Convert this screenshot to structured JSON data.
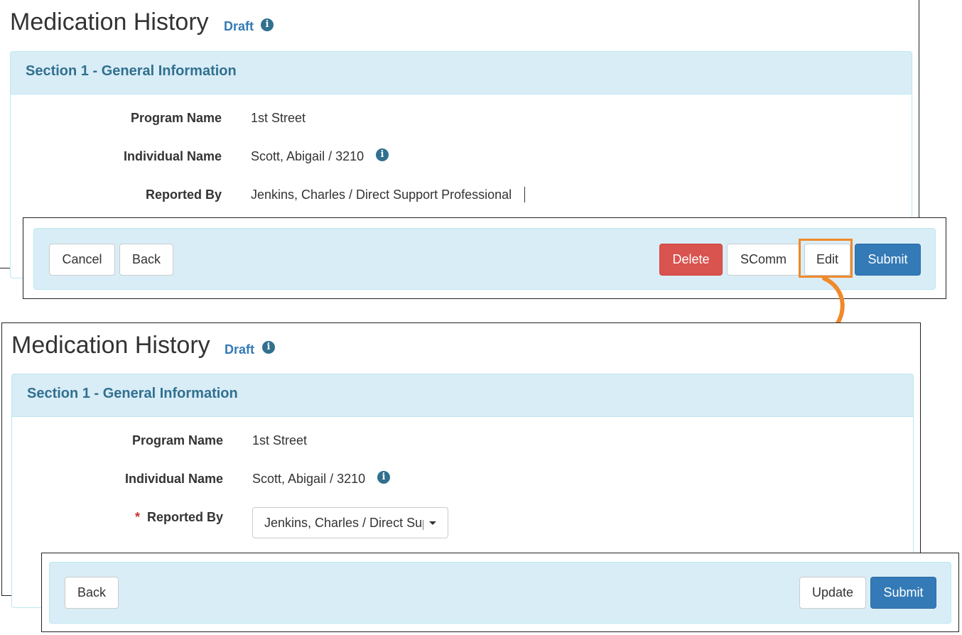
{
  "view_screen": {
    "title": "Medication History",
    "status": "Draft",
    "section_title": "Section 1 - General Information",
    "fields": [
      {
        "label": "Program Name",
        "value": "1st Street"
      },
      {
        "label": "Individual Name",
        "value": "Scott, Abigail / 3210"
      },
      {
        "label": "Reported By",
        "value": "Jenkins, Charles / Direct Support Professional"
      }
    ],
    "buttons": {
      "cancel": "Cancel",
      "back": "Back",
      "delete": "Delete",
      "scomm": "SComm",
      "edit": "Edit",
      "submit": "Submit"
    }
  },
  "edit_screen": {
    "title": "Medication History",
    "status": "Draft",
    "section_title": "Section 1 - General Information",
    "fields": [
      {
        "label": "Program Name",
        "value": "1st Street"
      },
      {
        "label": "Individual Name",
        "value": "Scott, Abigail / 3210"
      },
      {
        "label": "Reported By",
        "value": "Jenkins, Charles / Direct Support Professional",
        "required_marker": "*"
      }
    ],
    "buttons": {
      "back": "Back",
      "update": "Update",
      "submit": "Submit"
    }
  },
  "icons": {
    "info": "info-circle-icon",
    "dropdown": "caret-down-icon",
    "annotation": "curved-arrow-icon"
  },
  "colors": {
    "panel_heading_bg": "#d9edf7",
    "panel_title": "#31708f",
    "primary": "#337ab7",
    "danger": "#d9534f",
    "highlight": "#f0892a"
  }
}
